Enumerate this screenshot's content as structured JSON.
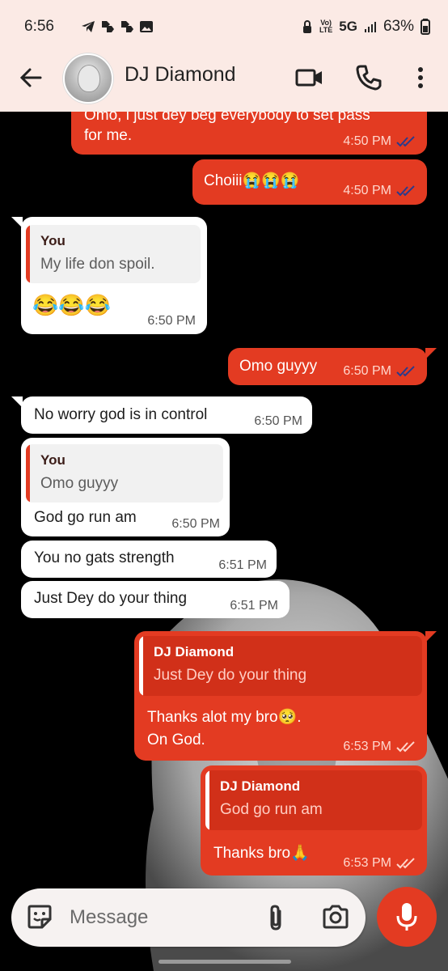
{
  "status": {
    "time": "6:56",
    "volte": "Vo)\nLTE",
    "network": "5G",
    "battery": "63%"
  },
  "header": {
    "contact_name": "DJ Diamond"
  },
  "messages": {
    "m1": {
      "text1": "Omo, i just dey beg everybody to set pass",
      "text2": "for me.",
      "time": "4:50 PM"
    },
    "m2": {
      "text": "Choiii😭😭😭",
      "time": "4:50 PM"
    },
    "m3": {
      "quote_name": "You",
      "quote_text": "My life don spoil.",
      "text": "😂😂😂",
      "time": "6:50 PM"
    },
    "m4": {
      "text": "Omo guyyy",
      "time": "6:50 PM"
    },
    "m5": {
      "text": "No worry god is in control",
      "time": "6:50 PM"
    },
    "m6": {
      "quote_name": "You",
      "quote_text": "Omo guyyy",
      "text": "God go run am",
      "time": "6:50 PM"
    },
    "m7": {
      "text": "You no gats strength",
      "time": "6:51 PM"
    },
    "m8": {
      "text": "Just Dey do your thing",
      "time": "6:51 PM"
    },
    "m9": {
      "quote_name": "DJ Diamond",
      "quote_text": "Just Dey do your thing",
      "text1": "Thanks alot my bro🥺.",
      "text2": "On God.",
      "time": "6:53 PM"
    },
    "m10": {
      "quote_name": "DJ Diamond",
      "quote_text": "God go run am",
      "text": "Thanks bro🙏",
      "time": "6:53 PM"
    }
  },
  "composer": {
    "placeholder": "Message"
  },
  "colors": {
    "accent": "#e33b22",
    "header_bg": "#fbeae5",
    "read_tick": "#2a3a8c"
  }
}
